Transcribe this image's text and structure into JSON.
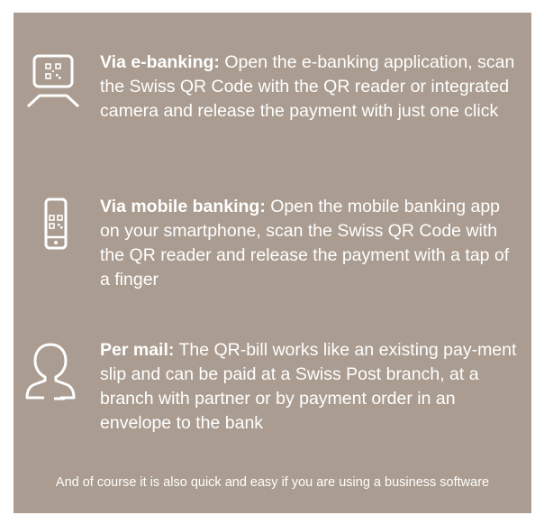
{
  "items": [
    {
      "icon": "monitor-qr-icon",
      "title": "Via e-banking:",
      "text": "Open the e-banking application, scan the Swiss QR Code with the QR reader or integrated camera and release the payment with just one click"
    },
    {
      "icon": "smartphone-qr-icon",
      "title": "Via mobile banking:",
      "text": "Open the mobile banking app on your smartphone, scan the Swiss QR Code with the QR reader and release the payment with a tap of a finger"
    },
    {
      "icon": "person-icon",
      "title": "Per mail:",
      "text": "The QR-bill works like an existing pay-ment slip and can be paid at a Swiss Post branch, at a branch with partner or by payment order in an envelope to the bank"
    }
  ],
  "footer": "And of course it is also quick and easy if you are using a business software",
  "colors": {
    "card_background": "#aa9c90",
    "text": "#ffffff"
  }
}
